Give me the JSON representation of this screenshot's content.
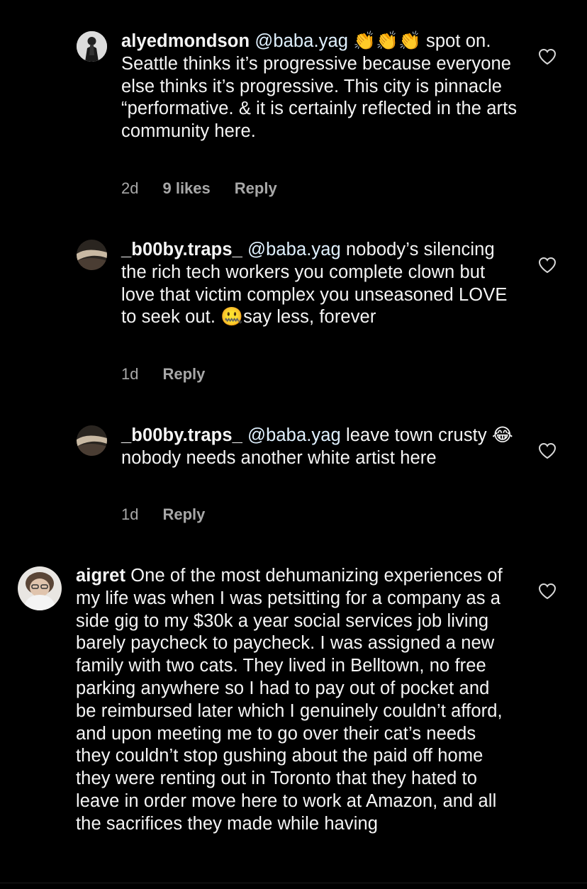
{
  "comments": [
    {
      "username": "alyedmondson",
      "mention": "@baba.yag",
      "emoji": "👏👏👏",
      "text": " spot on. Seattle thinks it’s progressive because everyone else thinks it’s progressive. This city is pinnacle “performative. & it is certainly reflected in the arts community here.",
      "time": "2d",
      "likes": "9 likes",
      "reply": "Reply",
      "avatar_icon": "profile-photo",
      "like_icon": "heart-outline-icon"
    },
    {
      "username": "_b00by.traps_",
      "mention": "@baba.yag",
      "text_a": " nobody’s silencing the rich tech workers you complete clown but love that victim complex you unseasoned LOVE to seek out. ",
      "emoji": "🤐",
      "text_b": "say less, forever",
      "time": "1d",
      "reply": "Reply",
      "avatar_icon": "profile-photo",
      "like_icon": "heart-outline-icon"
    },
    {
      "username": "_b00by.traps_",
      "mention": "@baba.yag",
      "text_a": " leave town crusty ",
      "emoji": "😂",
      "text_b": " nobody needs another white artist here",
      "time": "1d",
      "reply": "Reply",
      "avatar_icon": "profile-photo",
      "like_icon": "heart-outline-icon"
    },
    {
      "username": "aigret",
      "text": " One of the most dehumanizing experiences of my life was when I was petsitting for a company as a side gig to my $30k a year social services job living barely paycheck to paycheck. I was assigned a new family with two cats. They lived in Belltown, no free parking anywhere so I had to pay out of pocket and be reimbursed later which I genuinely couldn’t afford, and upon meeting me to go over their cat’s needs they couldn’t stop gushing about the paid off home they were renting out in Toronto that they hated to leave in order move here to work at Amazon, and all the sacrifices they made while having",
      "avatar_icon": "profile-photo",
      "like_icon": "heart-outline-icon"
    }
  ],
  "colors": {
    "background": "#000000",
    "text": "#f5f5f5",
    "meta": "#a8a8a8"
  }
}
